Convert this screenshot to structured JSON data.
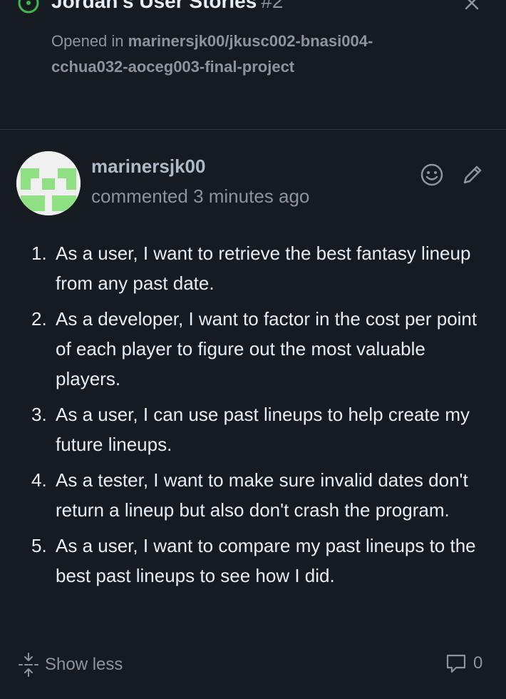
{
  "issue": {
    "title": "Jordan's User Stories",
    "number": "#2",
    "opened_prefix": "Opened in ",
    "repository": "marinersjk00/jkusc002-bnasi004-cchua032-aoceg003-final-project",
    "status_color": "#3fb950"
  },
  "comment": {
    "author": "marinersjk00",
    "meta": "commented 3 minutes ago",
    "stories": [
      {
        "num": "1.",
        "text": "As a user, I want to retrieve the best fantasy lineup from any past date."
      },
      {
        "num": "2.",
        "text": "As a developer, I want to factor in the cost per point of each player to figure out the most valuable players."
      },
      {
        "num": "3.",
        "text": "As a user, I can use past lineups to help create my future lineups."
      },
      {
        "num": "4.",
        "text": "As a tester, I want to make sure invalid dates don't return a lineup but also don't crash the program."
      },
      {
        "num": "5.",
        "text": "As a user, I want to compare my past lineups to the best past lineups to see how I did."
      }
    ]
  },
  "footer": {
    "show_less_label": "Show less",
    "comment_count": "0"
  },
  "colors": {
    "background": "#161b22",
    "text": "#e6edf3",
    "muted": "#8b949e",
    "avatar_green": "#8ee082"
  },
  "icons": [
    "issue-open-icon",
    "close-icon",
    "emoji-icon",
    "edit-icon",
    "unfold-icon",
    "comment-icon"
  ]
}
